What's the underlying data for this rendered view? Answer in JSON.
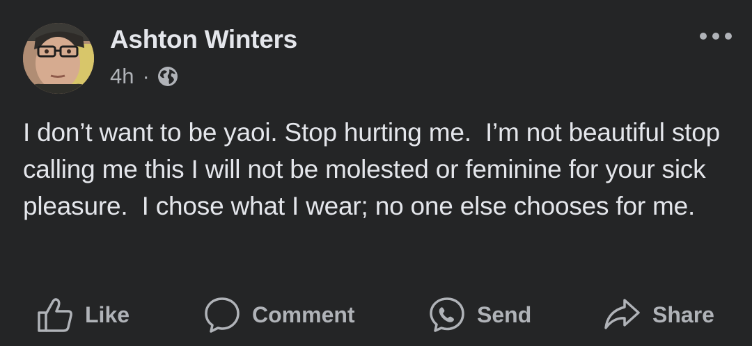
{
  "post": {
    "author": "Ashton Winters",
    "timestamp": "4h",
    "separator": "·",
    "audience_icon": "globe-icon",
    "more_icon": "more-options-icon",
    "text": "I don’t want to be yaoi. Stop hurting me.  I’m not beautiful stop calling me this I will not be molested or feminine for your sick pleasure.  I chose what I wear; no one else chooses for me."
  },
  "actions": {
    "like_label": "Like",
    "comment_label": "Comment",
    "send_label": "Send",
    "share_label": "Share"
  },
  "colors": {
    "background": "#242526",
    "primary_text": "#e4e6eb",
    "secondary_text": "#b0b3b8"
  }
}
